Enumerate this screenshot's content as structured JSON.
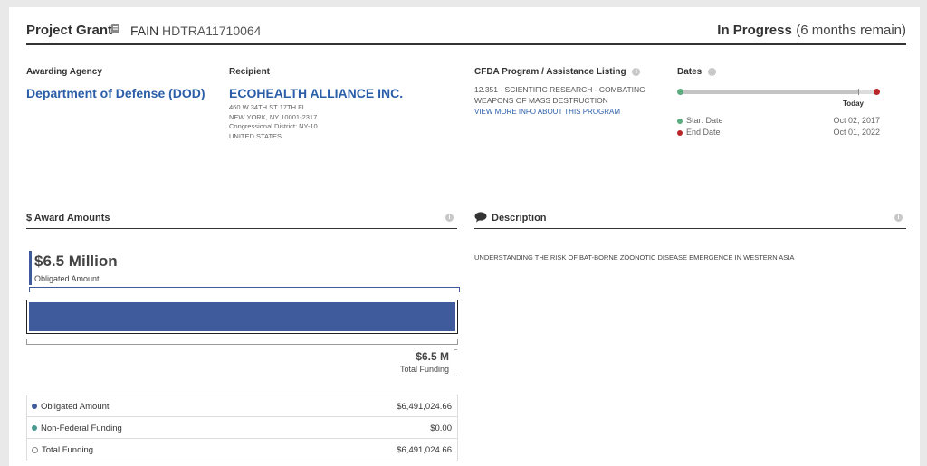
{
  "header": {
    "title": "Project Grant",
    "fain_label": "FAIN",
    "fain_value": "HDTRA11710064",
    "status": "In Progress",
    "status_detail": "(6 months remain)"
  },
  "awarding_agency": {
    "label": "Awarding Agency",
    "name": "Department of Defense (DOD)"
  },
  "recipient": {
    "label": "Recipient",
    "name": "ECOHEALTH ALLIANCE INC.",
    "address": [
      "460 W 34TH ST 17TH FL",
      "NEW YORK, NY 10001-2317",
      "Congressional District: NY-10",
      "UNITED STATES"
    ]
  },
  "cfda": {
    "label": "CFDA Program / Assistance Listing",
    "program": "12.351 - SCIENTIFIC RESEARCH - COMBATING WEAPONS OF MASS DESTRUCTION",
    "link": "VIEW MORE INFO ABOUT THIS PROGRAM"
  },
  "dates": {
    "label": "Dates",
    "today_label": "Today",
    "progress_fraction": 0.9,
    "start_label": "Start Date",
    "start_value": "Oct 02, 2017",
    "end_label": "End Date",
    "end_value": "Oct 01, 2022",
    "start_color": "#5bab7e",
    "end_color": "#b9262a"
  },
  "award_amounts": {
    "label": "$ Award Amounts",
    "obligated_big": "$6.5 Million",
    "obligated_caption": "Obligated Amount",
    "total_big": "$6.5 M",
    "total_caption": "Total Funding",
    "bar_fraction": 1.0,
    "bar_color": "#3f5b9b",
    "legend": [
      {
        "label": "Obligated Amount",
        "value": "$6,491,024.66",
        "color": "#3f5b9b",
        "hollow": false
      },
      {
        "label": "Non-Federal Funding",
        "value": "$0.00",
        "color": "#4a9a91",
        "hollow": false
      },
      {
        "label": "Total Funding",
        "value": "$6,491,024.66",
        "color": "#888888",
        "hollow": true
      }
    ]
  },
  "description": {
    "label": "Description",
    "text": "UNDERSTANDING THE RISK OF BAT-BORNE ZOONOTIC DISEASE EMERGENCE IN WESTERN ASIA"
  }
}
